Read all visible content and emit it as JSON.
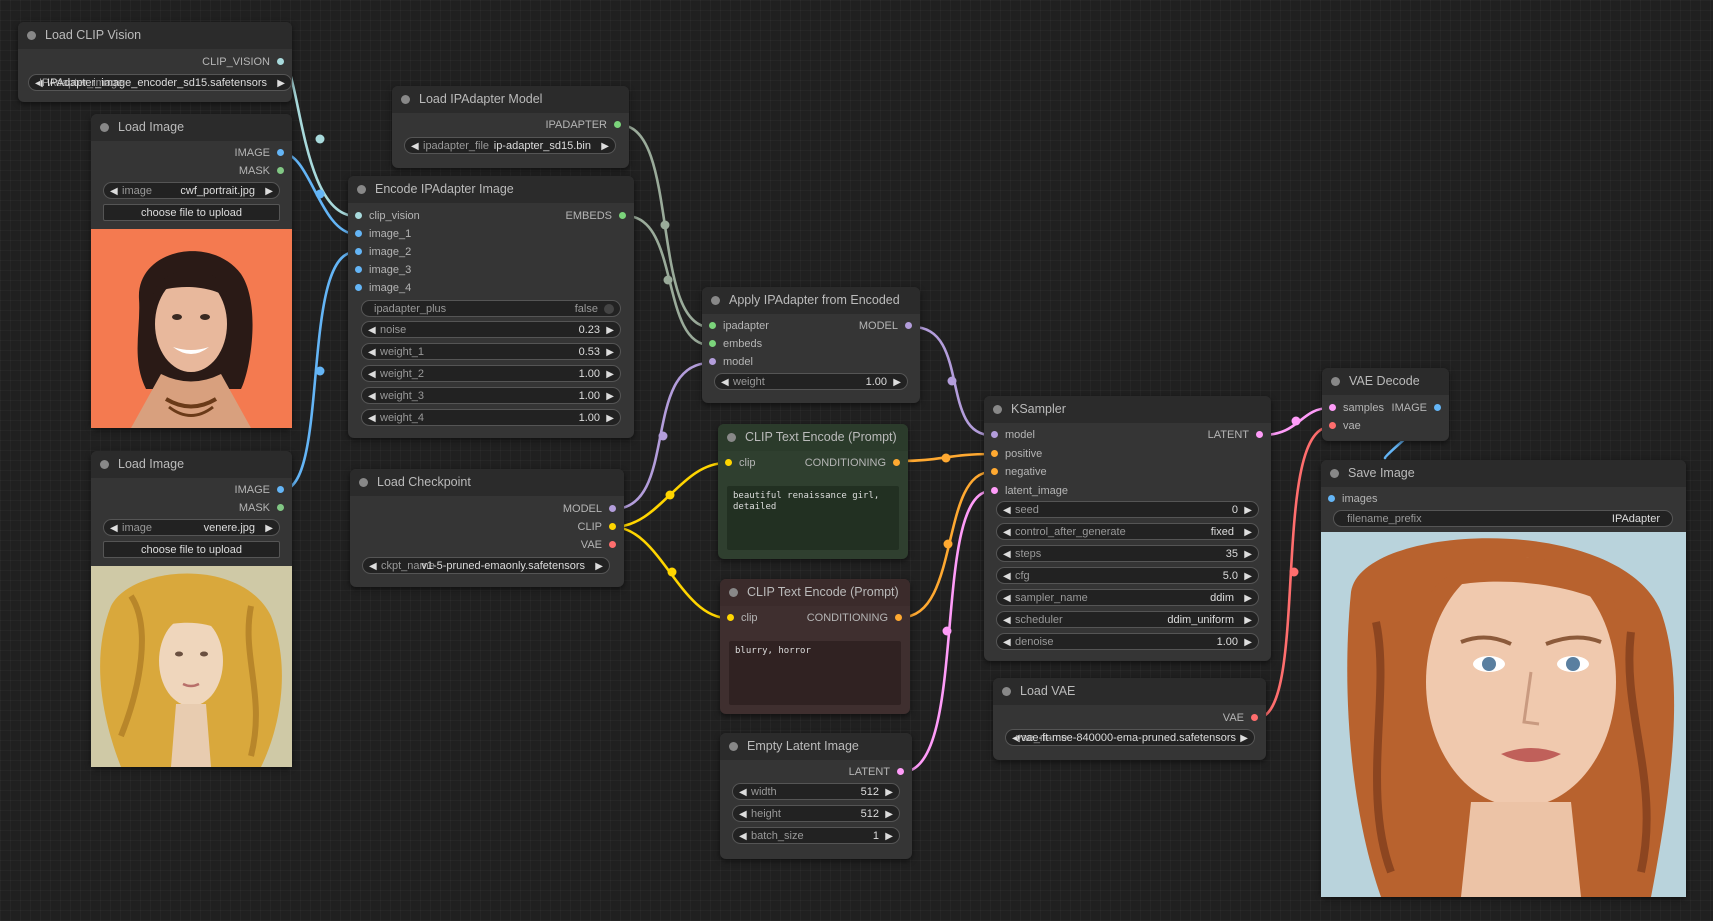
{
  "colors": {
    "clip_vision": "#a8dadc",
    "image": "#64b5f6",
    "mask": "#81c784",
    "ipadapter": "#7bd47b",
    "embeds": "#7bd47b",
    "model": "#b39ddb",
    "clip": "#ffd500",
    "vae": "#ff6e6e",
    "conditioning": "#ffa931",
    "latent": "#ff9cf9"
  },
  "nodes": {
    "load_clip_vision": {
      "title": "Load CLIP Vision",
      "output": "CLIP_VISION",
      "clip_name": {
        "label": "IPAdapter_image",
        "value": "IPAdapter_image_encoder_sd15.safetensors"
      }
    },
    "load_image_1": {
      "title": "Load Image",
      "outputs": [
        "IMAGE",
        "MASK"
      ],
      "image": {
        "label": "image",
        "value": "cwf_portrait.jpg"
      },
      "upload": "choose file to upload"
    },
    "load_image_2": {
      "title": "Load Image",
      "outputs": [
        "IMAGE",
        "MASK"
      ],
      "image": {
        "label": "image",
        "value": "venere.jpg"
      },
      "upload": "choose file to upload"
    },
    "load_ipadapter_model": {
      "title": "Load IPAdapter Model",
      "output": "IPADAPTER",
      "file": {
        "label": "ipadapter_file",
        "value": "ip-adapter_sd15.bin"
      }
    },
    "encode_ipadapter": {
      "title": "Encode IPAdapter Image",
      "inputs": [
        "clip_vision",
        "image_1",
        "image_2",
        "image_3",
        "image_4"
      ],
      "output": "EMBEDS",
      "ipadapter_plus": {
        "label": "ipadapter_plus",
        "value": "false"
      },
      "noise": {
        "label": "noise",
        "value": "0.23"
      },
      "weight_1": {
        "label": "weight_1",
        "value": "0.53"
      },
      "weight_2": {
        "label": "weight_2",
        "value": "1.00"
      },
      "weight_3": {
        "label": "weight_3",
        "value": "1.00"
      },
      "weight_4": {
        "label": "weight_4",
        "value": "1.00"
      }
    },
    "load_checkpoint": {
      "title": "Load Checkpoint",
      "outputs": [
        "MODEL",
        "CLIP",
        "VAE"
      ],
      "ckpt": {
        "label": "ckpt_name",
        "value": "v1-5-pruned-emaonly.safetensors"
      }
    },
    "apply_ipadapter": {
      "title": "Apply IPAdapter from Encoded",
      "inputs": [
        "ipadapter",
        "embeds",
        "model"
      ],
      "output": "MODEL",
      "weight": {
        "label": "weight",
        "value": "1.00"
      }
    },
    "clip_pos": {
      "title": "CLIP Text Encode (Prompt)",
      "input": "clip",
      "output": "CONDITIONING",
      "text": "beautiful renaissance girl, detailed"
    },
    "clip_neg": {
      "title": "CLIP Text Encode (Prompt)",
      "input": "clip",
      "output": "CONDITIONING",
      "text": "blurry, horror"
    },
    "empty_latent": {
      "title": "Empty Latent Image",
      "output": "LATENT",
      "width": {
        "label": "width",
        "value": "512"
      },
      "height": {
        "label": "height",
        "value": "512"
      },
      "batch_size": {
        "label": "batch_size",
        "value": "1"
      }
    },
    "ksampler": {
      "title": "KSampler",
      "inputs": [
        "model",
        "positive",
        "negative",
        "latent_image"
      ],
      "output": "LATENT",
      "seed": {
        "label": "seed",
        "value": "0"
      },
      "control_after_generate": {
        "label": "control_after_generate",
        "value": "fixed"
      },
      "steps": {
        "label": "steps",
        "value": "35"
      },
      "cfg": {
        "label": "cfg",
        "value": "5.0"
      },
      "sampler_name": {
        "label": "sampler_name",
        "value": "ddim"
      },
      "scheduler": {
        "label": "scheduler",
        "value": "ddim_uniform"
      },
      "denoise": {
        "label": "denoise",
        "value": "1.00"
      }
    },
    "load_vae": {
      "title": "Load VAE",
      "output": "VAE",
      "vae": {
        "label": "vae_name",
        "value": "vae-ft-mse-840000-ema-pruned.safetensors"
      }
    },
    "vae_decode": {
      "title": "VAE Decode",
      "inputs": [
        "samples",
        "vae"
      ],
      "output": "IMAGE"
    },
    "save_image": {
      "title": "Save Image",
      "input": "images",
      "filename_prefix": {
        "label": "filename_prefix",
        "value": "IPAdapter"
      }
    }
  }
}
